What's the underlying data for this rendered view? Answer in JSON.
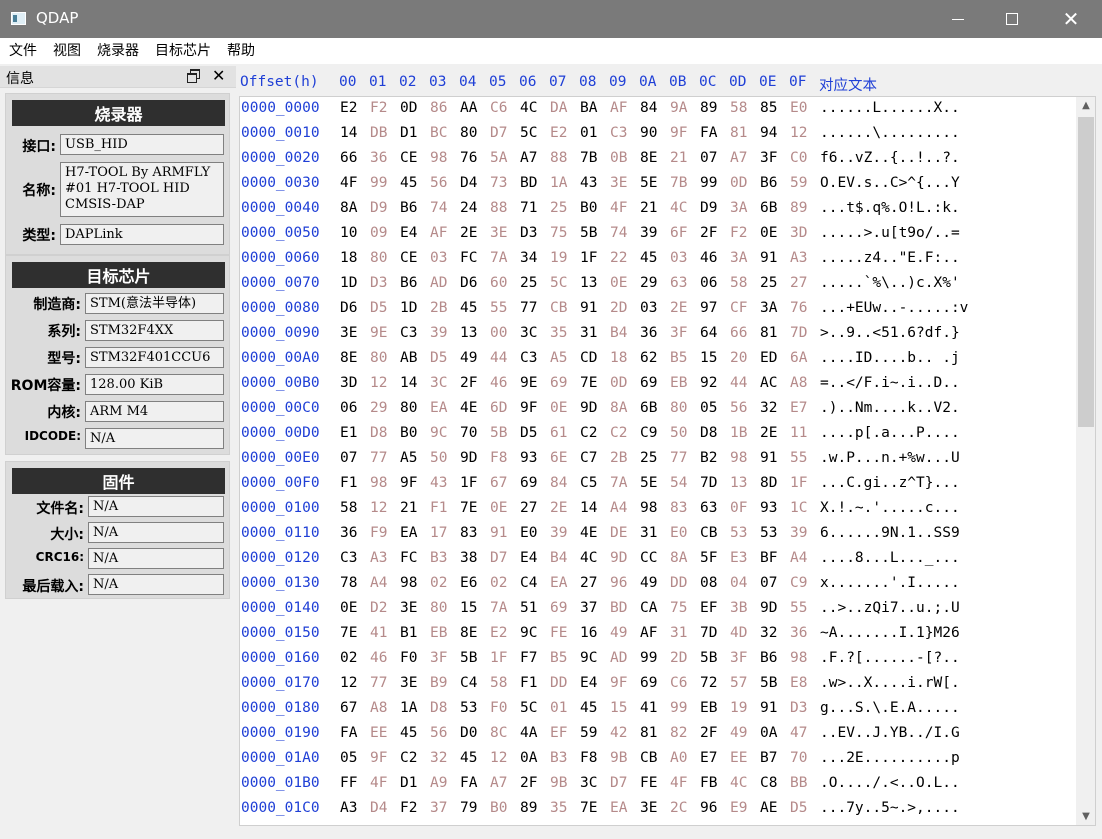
{
  "window": {
    "title": "QDAP",
    "minimize_icon": "minimize-icon",
    "maximize_icon": "maximize-icon",
    "close_icon": "close-icon"
  },
  "menu": [
    "文件",
    "视图",
    "烧录器",
    "目标芯片",
    "帮助"
  ],
  "dock": {
    "title": "信息",
    "programmer": {
      "title": "烧录器",
      "fields": [
        {
          "label": "接口:",
          "value": "USB_HID"
        },
        {
          "label": "名称:",
          "value": "H7-TOOL By ARMFLY\n#01 H7-TOOL HID\nCMSIS-DAP"
        },
        {
          "label": "类型:",
          "value": "DAPLink"
        }
      ]
    },
    "target": {
      "title": "目标芯片",
      "fields": [
        {
          "label": "制造商:",
          "value": "STM(意法半导体)"
        },
        {
          "label": "系列:",
          "value": "STM32F4XX"
        },
        {
          "label": "型号:",
          "value": "STM32F401CCU6"
        },
        {
          "label": "ROM容量:",
          "value": "128.00 KiB"
        },
        {
          "label": "内核:",
          "value": "ARM M4"
        },
        {
          "label": "IDCODE:",
          "value": "N/A"
        }
      ]
    },
    "firmware": {
      "title": "固件",
      "fields": [
        {
          "label": "文件名:",
          "value": "N/A"
        },
        {
          "label": "大小:",
          "value": "N/A"
        },
        {
          "label": "CRC16:",
          "value": "N/A"
        },
        {
          "label": "最后载入:",
          "value": "N/A"
        }
      ]
    }
  },
  "hex": {
    "offset_header": "Offset(h)",
    "columns": [
      "00",
      "01",
      "02",
      "03",
      "04",
      "05",
      "06",
      "07",
      "08",
      "09",
      "0A",
      "0B",
      "0C",
      "0D",
      "0E",
      "0F"
    ],
    "ascii_header": "对应文本",
    "rows": [
      {
        "offset": "0000_0000",
        "bytes": [
          "E2",
          "F2",
          "0D",
          "86",
          "AA",
          "C6",
          "4C",
          "DA",
          "BA",
          "AF",
          "84",
          "9A",
          "89",
          "58",
          "85",
          "E0"
        ],
        "ascii": "......L......X.."
      },
      {
        "offset": "0000_0010",
        "bytes": [
          "14",
          "DB",
          "D1",
          "BC",
          "80",
          "D7",
          "5C",
          "E2",
          "01",
          "C3",
          "90",
          "9F",
          "FA",
          "81",
          "94",
          "12"
        ],
        "ascii": "......\\........."
      },
      {
        "offset": "0000_0020",
        "bytes": [
          "66",
          "36",
          "CE",
          "98",
          "76",
          "5A",
          "A7",
          "88",
          "7B",
          "0B",
          "8E",
          "21",
          "07",
          "A7",
          "3F",
          "C0"
        ],
        "ascii": "f6..vZ..{..!..?."
      },
      {
        "offset": "0000_0030",
        "bytes": [
          "4F",
          "99",
          "45",
          "56",
          "D4",
          "73",
          "BD",
          "1A",
          "43",
          "3E",
          "5E",
          "7B",
          "99",
          "0D",
          "B6",
          "59"
        ],
        "ascii": "O.EV.s..C>^{...Y"
      },
      {
        "offset": "0000_0040",
        "bytes": [
          "8A",
          "D9",
          "B6",
          "74",
          "24",
          "88",
          "71",
          "25",
          "B0",
          "4F",
          "21",
          "4C",
          "D9",
          "3A",
          "6B",
          "89"
        ],
        "ascii": "...t$.q%.O!L.:k."
      },
      {
        "offset": "0000_0050",
        "bytes": [
          "10",
          "09",
          "E4",
          "AF",
          "2E",
          "3E",
          "D3",
          "75",
          "5B",
          "74",
          "39",
          "6F",
          "2F",
          "F2",
          "0E",
          "3D"
        ],
        "ascii": ".....>.u[t9o/..="
      },
      {
        "offset": "0000_0060",
        "bytes": [
          "18",
          "80",
          "CE",
          "03",
          "FC",
          "7A",
          "34",
          "19",
          "1F",
          "22",
          "45",
          "03",
          "46",
          "3A",
          "91",
          "A3"
        ],
        "ascii": ".....z4..\"E.F:.."
      },
      {
        "offset": "0000_0070",
        "bytes": [
          "1D",
          "D3",
          "B6",
          "AD",
          "D6",
          "60",
          "25",
          "5C",
          "13",
          "0E",
          "29",
          "63",
          "06",
          "58",
          "25",
          "27"
        ],
        "ascii": ".....`%\\..)c.X%'"
      },
      {
        "offset": "0000_0080",
        "bytes": [
          "D6",
          "D5",
          "1D",
          "2B",
          "45",
          "55",
          "77",
          "CB",
          "91",
          "2D",
          "03",
          "2E",
          "97",
          "CF",
          "3A",
          "76"
        ],
        "ascii": "...+EUw..-.....:v"
      },
      {
        "offset": "0000_0090",
        "bytes": [
          "3E",
          "9E",
          "C3",
          "39",
          "13",
          "00",
          "3C",
          "35",
          "31",
          "B4",
          "36",
          "3F",
          "64",
          "66",
          "81",
          "7D"
        ],
        "ascii": ">..9..<51.6?df.}"
      },
      {
        "offset": "0000_00A0",
        "bytes": [
          "8E",
          "80",
          "AB",
          "D5",
          "49",
          "44",
          "C3",
          "A5",
          "CD",
          "18",
          "62",
          "B5",
          "15",
          "20",
          "ED",
          "6A"
        ],
        "ascii": "....ID....b.. .j"
      },
      {
        "offset": "0000_00B0",
        "bytes": [
          "3D",
          "12",
          "14",
          "3C",
          "2F",
          "46",
          "9E",
          "69",
          "7E",
          "0D",
          "69",
          "EB",
          "92",
          "44",
          "AC",
          "A8"
        ],
        "ascii": "=..</F.i~.i..D.."
      },
      {
        "offset": "0000_00C0",
        "bytes": [
          "06",
          "29",
          "80",
          "EA",
          "4E",
          "6D",
          "9F",
          "0E",
          "9D",
          "8A",
          "6B",
          "80",
          "05",
          "56",
          "32",
          "E7"
        ],
        "ascii": ".)..Nm....k..V2."
      },
      {
        "offset": "0000_00D0",
        "bytes": [
          "E1",
          "D8",
          "B0",
          "9C",
          "70",
          "5B",
          "D5",
          "61",
          "C2",
          "C2",
          "C9",
          "50",
          "D8",
          "1B",
          "2E",
          "11"
        ],
        "ascii": "....p[.a...P...."
      },
      {
        "offset": "0000_00E0",
        "bytes": [
          "07",
          "77",
          "A5",
          "50",
          "9D",
          "F8",
          "93",
          "6E",
          "C7",
          "2B",
          "25",
          "77",
          "B2",
          "98",
          "91",
          "55"
        ],
        "ascii": ".w.P...n.+%w...U"
      },
      {
        "offset": "0000_00F0",
        "bytes": [
          "F1",
          "98",
          "9F",
          "43",
          "1F",
          "67",
          "69",
          "84",
          "C5",
          "7A",
          "5E",
          "54",
          "7D",
          "13",
          "8D",
          "1F"
        ],
        "ascii": "...C.gi..z^T}..."
      },
      {
        "offset": "0000_0100",
        "bytes": [
          "58",
          "12",
          "21",
          "F1",
          "7E",
          "0E",
          "27",
          "2E",
          "14",
          "A4",
          "98",
          "83",
          "63",
          "0F",
          "93",
          "1C"
        ],
        "ascii": "X.!.~.'.....c..."
      },
      {
        "offset": "0000_0110",
        "bytes": [
          "36",
          "F9",
          "EA",
          "17",
          "83",
          "91",
          "E0",
          "39",
          "4E",
          "DE",
          "31",
          "E0",
          "CB",
          "53",
          "53",
          "39"
        ],
        "ascii": "6......9N.1..SS9"
      },
      {
        "offset": "0000_0120",
        "bytes": [
          "C3",
          "A3",
          "FC",
          "B3",
          "38",
          "D7",
          "E4",
          "B4",
          "4C",
          "9D",
          "CC",
          "8A",
          "5F",
          "E3",
          "BF",
          "A4"
        ],
        "ascii": "....8...L..._..."
      },
      {
        "offset": "0000_0130",
        "bytes": [
          "78",
          "A4",
          "98",
          "02",
          "E6",
          "02",
          "C4",
          "EA",
          "27",
          "96",
          "49",
          "DD",
          "08",
          "04",
          "07",
          "C9"
        ],
        "ascii": "x.......'.I....."
      },
      {
        "offset": "0000_0140",
        "bytes": [
          "0E",
          "D2",
          "3E",
          "80",
          "15",
          "7A",
          "51",
          "69",
          "37",
          "BD",
          "CA",
          "75",
          "EF",
          "3B",
          "9D",
          "55"
        ],
        "ascii": "..>..zQi7..u.;.U"
      },
      {
        "offset": "0000_0150",
        "bytes": [
          "7E",
          "41",
          "B1",
          "EB",
          "8E",
          "E2",
          "9C",
          "FE",
          "16",
          "49",
          "AF",
          "31",
          "7D",
          "4D",
          "32",
          "36"
        ],
        "ascii": "~A.......I.1}M26"
      },
      {
        "offset": "0000_0160",
        "bytes": [
          "02",
          "46",
          "F0",
          "3F",
          "5B",
          "1F",
          "F7",
          "B5",
          "9C",
          "AD",
          "99",
          "2D",
          "5B",
          "3F",
          "B6",
          "98"
        ],
        "ascii": ".F.?[......-[?.."
      },
      {
        "offset": "0000_0170",
        "bytes": [
          "12",
          "77",
          "3E",
          "B9",
          "C4",
          "58",
          "F1",
          "DD",
          "E4",
          "9F",
          "69",
          "C6",
          "72",
          "57",
          "5B",
          "E8"
        ],
        "ascii": ".w>..X....i.rW[."
      },
      {
        "offset": "0000_0180",
        "bytes": [
          "67",
          "A8",
          "1A",
          "D8",
          "53",
          "F0",
          "5C",
          "01",
          "45",
          "15",
          "41",
          "99",
          "EB",
          "19",
          "91",
          "D3"
        ],
        "ascii": "g...S.\\.E.A....."
      },
      {
        "offset": "0000_0190",
        "bytes": [
          "FA",
          "EE",
          "45",
          "56",
          "D0",
          "8C",
          "4A",
          "EF",
          "59",
          "42",
          "81",
          "82",
          "2F",
          "49",
          "0A",
          "47"
        ],
        "ascii": "..EV..J.YB../I.G"
      },
      {
        "offset": "0000_01A0",
        "bytes": [
          "05",
          "9F",
          "C2",
          "32",
          "45",
          "12",
          "0A",
          "B3",
          "F8",
          "9B",
          "CB",
          "A0",
          "E7",
          "EE",
          "B7",
          "70"
        ],
        "ascii": "...2E..........p"
      },
      {
        "offset": "0000_01B0",
        "bytes": [
          "FF",
          "4F",
          "D1",
          "A9",
          "FA",
          "A7",
          "2F",
          "9B",
          "3C",
          "D7",
          "FE",
          "4F",
          "FB",
          "4C",
          "C8",
          "BB"
        ],
        "ascii": ".O..../.<..O.L.."
      },
      {
        "offset": "0000_01C0",
        "bytes": [
          "A3",
          "D4",
          "F2",
          "37",
          "79",
          "B0",
          "89",
          "35",
          "7E",
          "EA",
          "3E",
          "2C",
          "96",
          "E9",
          "AE",
          "D5"
        ],
        "ascii": "...7y..5~.>,...."
      }
    ]
  }
}
